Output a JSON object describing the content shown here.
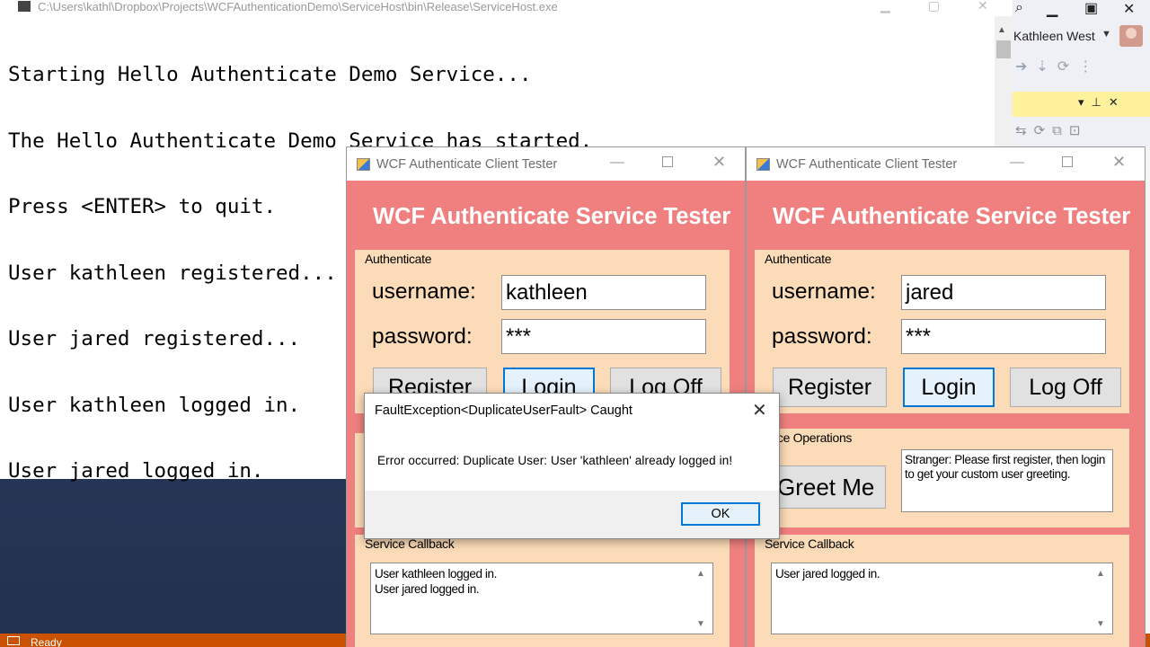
{
  "console": {
    "title": "C:\\Users\\kathl\\Dropbox\\Projects\\WCFAuthenticationDemo\\ServiceHost\\bin\\Release\\ServiceHost.exe",
    "lines": [
      "Starting Hello Authenticate Demo Service...",
      "The Hello Authenticate Demo Service has started.",
      "Press <ENTER> to quit.",
      "User kathleen registered...",
      "User jared registered...",
      "User kathleen logged in.",
      "User jared logged in."
    ]
  },
  "ide": {
    "user_name": "Kathleen West",
    "status": "Ready"
  },
  "windows": [
    {
      "title": "WCF Authenticate Client Tester",
      "heading": "WCF Authenticate Service Tester",
      "auth_group": "Authenticate",
      "username_label": "username:",
      "username_value": "kathleen",
      "password_label": "password:",
      "password_value": "***",
      "register_label": "Register",
      "login_label": "Login",
      "logoff_label": "Log Off",
      "callback_group": "Service Callback",
      "callback_lines": [
        "User kathleen logged in.",
        "User jared logged in."
      ]
    },
    {
      "title": "WCF Authenticate Client Tester",
      "heading": "WCF Authenticate Service Tester",
      "auth_group": "Authenticate",
      "username_label": "username:",
      "username_value": "jared",
      "password_label": "password:",
      "password_value": "***",
      "register_label": "Register",
      "login_label": "Login",
      "logoff_label": "Log Off",
      "ops_group": "rvice Operations",
      "greet_label": "Greet Me",
      "greeting_text": "Stranger: Please first register, then login to get your custom user greeting.",
      "callback_group": "Service Callback",
      "callback_lines": [
        "User jared logged in."
      ]
    }
  ],
  "dialog": {
    "title": "FaultException<DuplicateUserFault> Caught",
    "message": "Error occurred: Duplicate User: User 'kathleen' already logged in!",
    "ok_label": "OK"
  },
  "icons": [
    "console-app-icon",
    "window-app-icon",
    "close-icon",
    "minimize-icon",
    "maximize-icon",
    "scroll-up-icon",
    "scroll-down-icon",
    "user-avatar-icon",
    "pin-icon"
  ]
}
